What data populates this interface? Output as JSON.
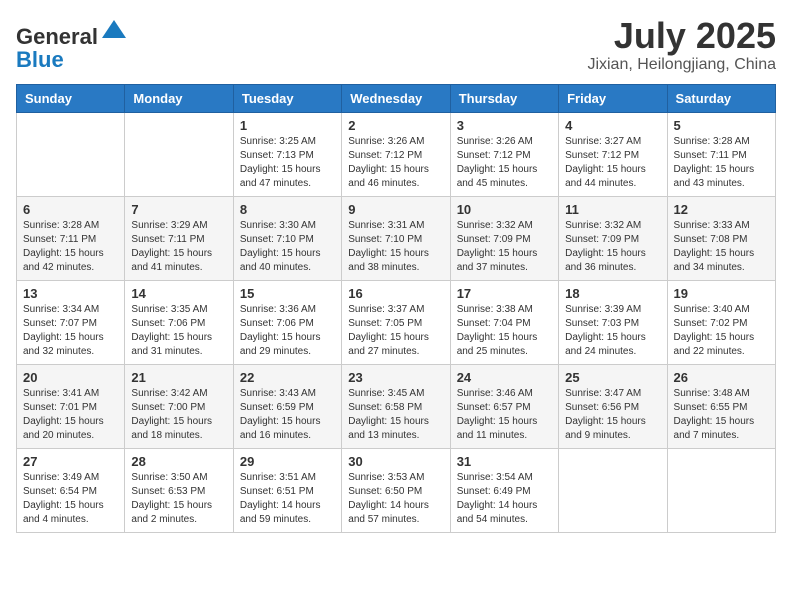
{
  "header": {
    "logo_general": "General",
    "logo_blue": "Blue",
    "month_title": "July 2025",
    "location": "Jixian, Heilongjiang, China"
  },
  "weekdays": [
    "Sunday",
    "Monday",
    "Tuesday",
    "Wednesday",
    "Thursday",
    "Friday",
    "Saturday"
  ],
  "weeks": [
    [
      {
        "day": "",
        "sunrise": "",
        "sunset": "",
        "daylight": ""
      },
      {
        "day": "",
        "sunrise": "",
        "sunset": "",
        "daylight": ""
      },
      {
        "day": "1",
        "sunrise": "Sunrise: 3:25 AM",
        "sunset": "Sunset: 7:13 PM",
        "daylight": "Daylight: 15 hours and 47 minutes."
      },
      {
        "day": "2",
        "sunrise": "Sunrise: 3:26 AM",
        "sunset": "Sunset: 7:12 PM",
        "daylight": "Daylight: 15 hours and 46 minutes."
      },
      {
        "day": "3",
        "sunrise": "Sunrise: 3:26 AM",
        "sunset": "Sunset: 7:12 PM",
        "daylight": "Daylight: 15 hours and 45 minutes."
      },
      {
        "day": "4",
        "sunrise": "Sunrise: 3:27 AM",
        "sunset": "Sunset: 7:12 PM",
        "daylight": "Daylight: 15 hours and 44 minutes."
      },
      {
        "day": "5",
        "sunrise": "Sunrise: 3:28 AM",
        "sunset": "Sunset: 7:11 PM",
        "daylight": "Daylight: 15 hours and 43 minutes."
      }
    ],
    [
      {
        "day": "6",
        "sunrise": "Sunrise: 3:28 AM",
        "sunset": "Sunset: 7:11 PM",
        "daylight": "Daylight: 15 hours and 42 minutes."
      },
      {
        "day": "7",
        "sunrise": "Sunrise: 3:29 AM",
        "sunset": "Sunset: 7:11 PM",
        "daylight": "Daylight: 15 hours and 41 minutes."
      },
      {
        "day": "8",
        "sunrise": "Sunrise: 3:30 AM",
        "sunset": "Sunset: 7:10 PM",
        "daylight": "Daylight: 15 hours and 40 minutes."
      },
      {
        "day": "9",
        "sunrise": "Sunrise: 3:31 AM",
        "sunset": "Sunset: 7:10 PM",
        "daylight": "Daylight: 15 hours and 38 minutes."
      },
      {
        "day": "10",
        "sunrise": "Sunrise: 3:32 AM",
        "sunset": "Sunset: 7:09 PM",
        "daylight": "Daylight: 15 hours and 37 minutes."
      },
      {
        "day": "11",
        "sunrise": "Sunrise: 3:32 AM",
        "sunset": "Sunset: 7:09 PM",
        "daylight": "Daylight: 15 hours and 36 minutes."
      },
      {
        "day": "12",
        "sunrise": "Sunrise: 3:33 AM",
        "sunset": "Sunset: 7:08 PM",
        "daylight": "Daylight: 15 hours and 34 minutes."
      }
    ],
    [
      {
        "day": "13",
        "sunrise": "Sunrise: 3:34 AM",
        "sunset": "Sunset: 7:07 PM",
        "daylight": "Daylight: 15 hours and 32 minutes."
      },
      {
        "day": "14",
        "sunrise": "Sunrise: 3:35 AM",
        "sunset": "Sunset: 7:06 PM",
        "daylight": "Daylight: 15 hours and 31 minutes."
      },
      {
        "day": "15",
        "sunrise": "Sunrise: 3:36 AM",
        "sunset": "Sunset: 7:06 PM",
        "daylight": "Daylight: 15 hours and 29 minutes."
      },
      {
        "day": "16",
        "sunrise": "Sunrise: 3:37 AM",
        "sunset": "Sunset: 7:05 PM",
        "daylight": "Daylight: 15 hours and 27 minutes."
      },
      {
        "day": "17",
        "sunrise": "Sunrise: 3:38 AM",
        "sunset": "Sunset: 7:04 PM",
        "daylight": "Daylight: 15 hours and 25 minutes."
      },
      {
        "day": "18",
        "sunrise": "Sunrise: 3:39 AM",
        "sunset": "Sunset: 7:03 PM",
        "daylight": "Daylight: 15 hours and 24 minutes."
      },
      {
        "day": "19",
        "sunrise": "Sunrise: 3:40 AM",
        "sunset": "Sunset: 7:02 PM",
        "daylight": "Daylight: 15 hours and 22 minutes."
      }
    ],
    [
      {
        "day": "20",
        "sunrise": "Sunrise: 3:41 AM",
        "sunset": "Sunset: 7:01 PM",
        "daylight": "Daylight: 15 hours and 20 minutes."
      },
      {
        "day": "21",
        "sunrise": "Sunrise: 3:42 AM",
        "sunset": "Sunset: 7:00 PM",
        "daylight": "Daylight: 15 hours and 18 minutes."
      },
      {
        "day": "22",
        "sunrise": "Sunrise: 3:43 AM",
        "sunset": "Sunset: 6:59 PM",
        "daylight": "Daylight: 15 hours and 16 minutes."
      },
      {
        "day": "23",
        "sunrise": "Sunrise: 3:45 AM",
        "sunset": "Sunset: 6:58 PM",
        "daylight": "Daylight: 15 hours and 13 minutes."
      },
      {
        "day": "24",
        "sunrise": "Sunrise: 3:46 AM",
        "sunset": "Sunset: 6:57 PM",
        "daylight": "Daylight: 15 hours and 11 minutes."
      },
      {
        "day": "25",
        "sunrise": "Sunrise: 3:47 AM",
        "sunset": "Sunset: 6:56 PM",
        "daylight": "Daylight: 15 hours and 9 minutes."
      },
      {
        "day": "26",
        "sunrise": "Sunrise: 3:48 AM",
        "sunset": "Sunset: 6:55 PM",
        "daylight": "Daylight: 15 hours and 7 minutes."
      }
    ],
    [
      {
        "day": "27",
        "sunrise": "Sunrise: 3:49 AM",
        "sunset": "Sunset: 6:54 PM",
        "daylight": "Daylight: 15 hours and 4 minutes."
      },
      {
        "day": "28",
        "sunrise": "Sunrise: 3:50 AM",
        "sunset": "Sunset: 6:53 PM",
        "daylight": "Daylight: 15 hours and 2 minutes."
      },
      {
        "day": "29",
        "sunrise": "Sunrise: 3:51 AM",
        "sunset": "Sunset: 6:51 PM",
        "daylight": "Daylight: 14 hours and 59 minutes."
      },
      {
        "day": "30",
        "sunrise": "Sunrise: 3:53 AM",
        "sunset": "Sunset: 6:50 PM",
        "daylight": "Daylight: 14 hours and 57 minutes."
      },
      {
        "day": "31",
        "sunrise": "Sunrise: 3:54 AM",
        "sunset": "Sunset: 6:49 PM",
        "daylight": "Daylight: 14 hours and 54 minutes."
      },
      {
        "day": "",
        "sunrise": "",
        "sunset": "",
        "daylight": ""
      },
      {
        "day": "",
        "sunrise": "",
        "sunset": "",
        "daylight": ""
      }
    ]
  ]
}
